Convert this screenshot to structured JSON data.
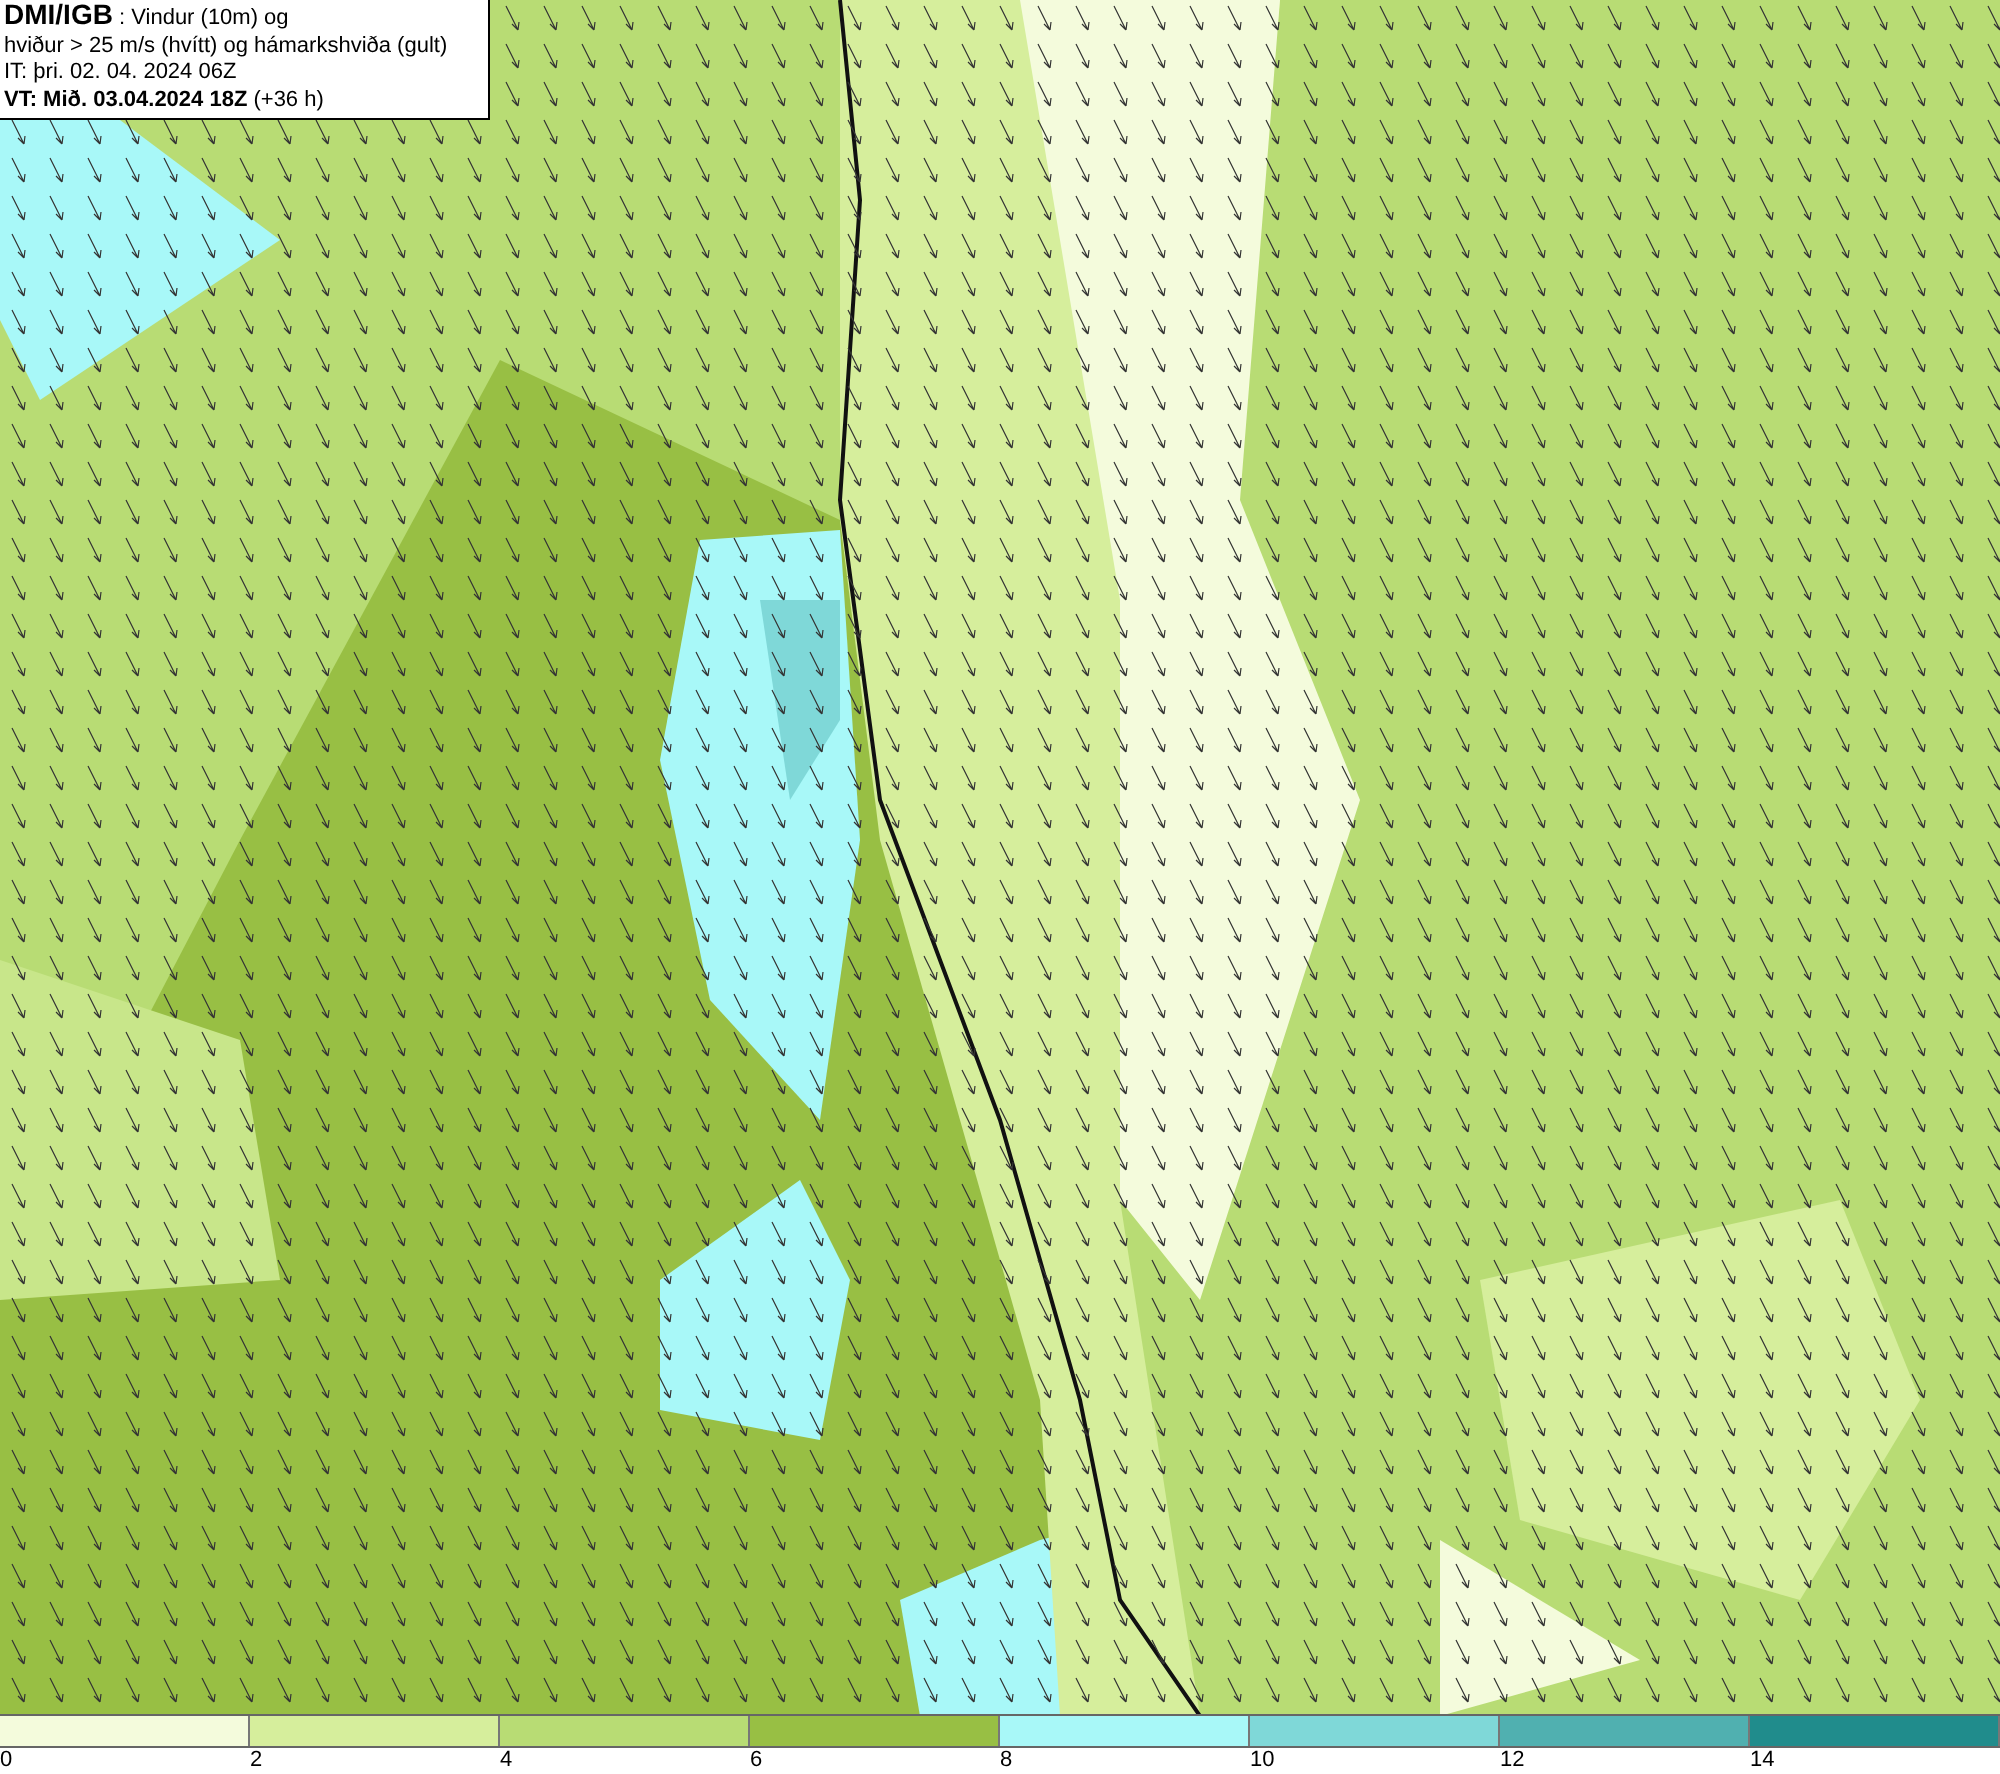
{
  "header": {
    "source": "DMI/IGB",
    "title": " : Vindur (10m) og",
    "subtitle": "hviður > 25 m/s (hvítt) og hámarkshviða (gult)",
    "issued": "IT: þri. 02. 04. 2024 06Z",
    "valid": "**VT: Mið. 03.04.2024 18Z** (+36 h)"
  },
  "legend": {
    "bins": [
      {
        "color": "#f4fbdc"
      },
      {
        "color": "#d6ee9c"
      },
      {
        "color": "#b8dc74"
      },
      {
        "color": "#98bf44"
      },
      {
        "color": "#a8f8f8"
      },
      {
        "color": "#7fd8d8"
      },
      {
        "color": "#50b0b0"
      },
      {
        "color": "#208c8c"
      }
    ],
    "ticks": [
      "0",
      "2",
      "4",
      "6",
      "8",
      "10",
      "12",
      "14"
    ]
  }
}
